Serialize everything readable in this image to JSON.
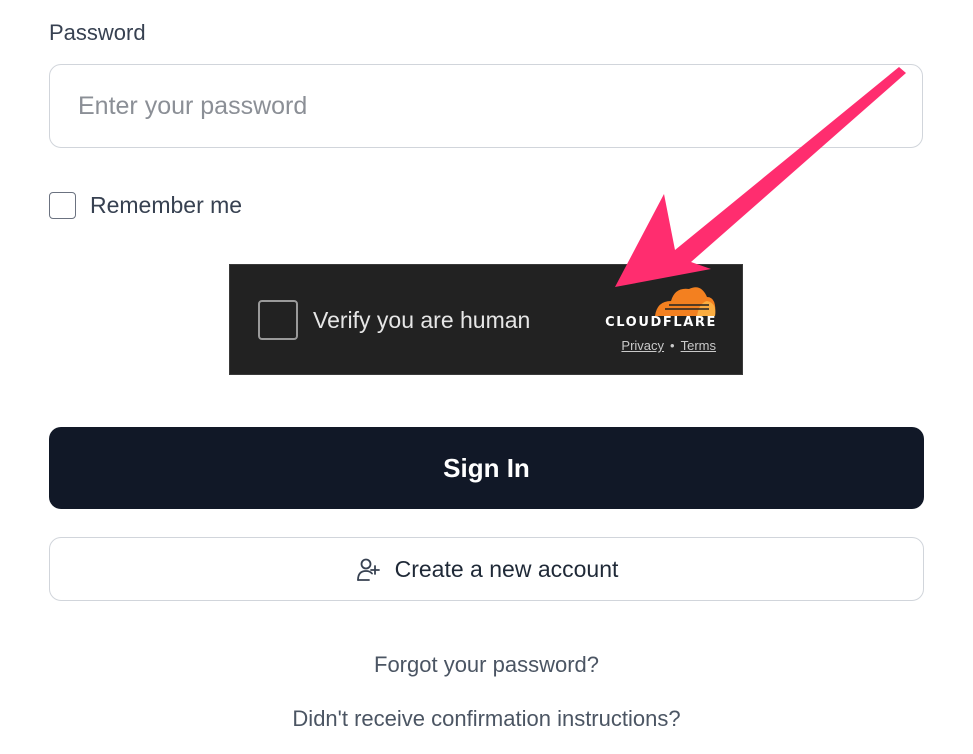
{
  "form": {
    "password_label": "Password",
    "password_placeholder": "Enter your password",
    "remember_label": "Remember me",
    "signin_label": "Sign In",
    "create_account_label": "Create a new account",
    "forgot_password_link": "Forgot your password?",
    "confirmation_link": "Didn't receive confirmation instructions?"
  },
  "captcha": {
    "checkbox_label": "Verify you are human",
    "brand": "CLOUDFLARE",
    "privacy_link": "Privacy",
    "separator": "•",
    "terms_link": "Terms"
  },
  "icons": {
    "create_account": "user-plus-icon",
    "captcha_logo": "cloudflare-cloud-icon",
    "annotation": "arrow-icon"
  },
  "colors": {
    "primary_button": "#111827",
    "captcha_background": "#222222",
    "cloudflare_orange": "#f38020",
    "cloudflare_light_orange": "#fbad41",
    "annotation_arrow": "#ff2d6f"
  }
}
